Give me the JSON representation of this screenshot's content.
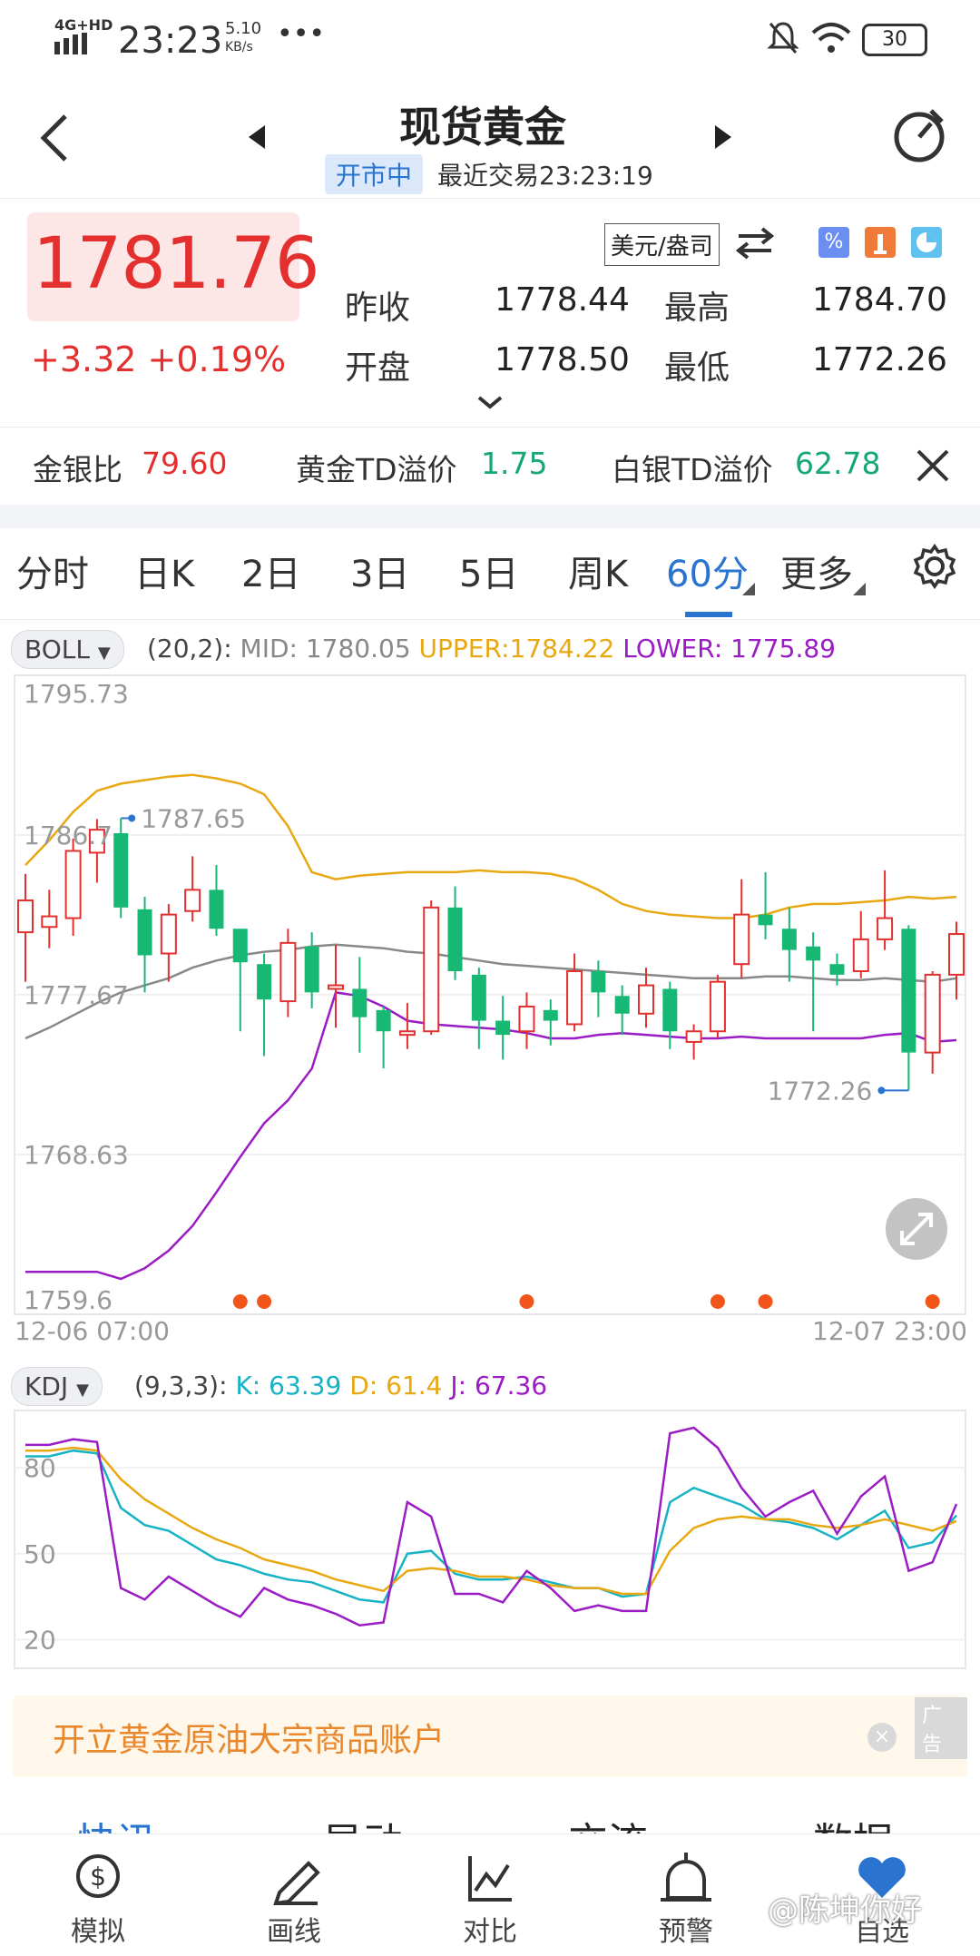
{
  "status": {
    "network": "4G+HD",
    "time": "23:23",
    "speed_value": "5.10",
    "speed_unit": "KB/s",
    "more": "•••",
    "battery": "30"
  },
  "header": {
    "title": "现货黄金",
    "market_status": "开市中",
    "last_trade": "最近交易23:23:19"
  },
  "quote": {
    "price": "1781.76",
    "change": "+3.32",
    "change_pct": "+0.19%",
    "unit": "美元/盎司",
    "prev_close_label": "昨收",
    "prev_close": "1778.44",
    "high_label": "最高",
    "high": "1784.70",
    "open_label": "开盘",
    "open": "1778.50",
    "low_label": "最低",
    "low": "1772.26"
  },
  "ratios": {
    "gold_silver_label": "金银比",
    "gold_silver": "79.60",
    "gold_td_label": "黄金TD溢价",
    "gold_td": "1.75",
    "silver_td_label": "白银TD溢价",
    "silver_td": "62.78"
  },
  "tabs": [
    "分时",
    "日K",
    "2日",
    "3日",
    "5日",
    "周K",
    "60分",
    "更多"
  ],
  "active_tab": "60分",
  "boll": {
    "name": "BOLL",
    "params": "(20,2):",
    "mid": "MID: 1780.05",
    "upper": "UPPER:1784.22",
    "lower": "LOWER: 1775.89"
  },
  "kdj": {
    "name": "KDJ",
    "params": "(9,3,3):",
    "k": "K: 63.39",
    "d": "D: 61.4",
    "j": "J: 67.36"
  },
  "chart_data": [
    {
      "type": "candlestick",
      "y_ticks": [
        "1795.73",
        "1786.7",
        "1777.67",
        "1768.63",
        "1759.6"
      ],
      "ylim": [
        1759.6,
        1795.73
      ],
      "x_start_label": "12-06 07:00",
      "x_end_label": "12-07 23:00",
      "max_annotation": "1787.65",
      "min_annotation": "1772.26",
      "candles": [
        {
          "o": 1781.2,
          "c": 1783.0,
          "h": 1784.5,
          "l": 1778.4
        },
        {
          "o": 1781.5,
          "c": 1782.1,
          "h": 1783.6,
          "l": 1780.3
        },
        {
          "o": 1782.0,
          "c": 1785.8,
          "h": 1786.5,
          "l": 1781.0
        },
        {
          "o": 1785.7,
          "c": 1787.0,
          "h": 1787.6,
          "l": 1784.0
        },
        {
          "o": 1786.8,
          "c": 1782.6,
          "h": 1787.65,
          "l": 1782.0
        },
        {
          "o": 1782.5,
          "c": 1779.9,
          "h": 1783.2,
          "l": 1777.8
        },
        {
          "o": 1780.0,
          "c": 1782.2,
          "h": 1782.8,
          "l": 1778.4
        },
        {
          "o": 1782.4,
          "c": 1783.6,
          "h": 1785.5,
          "l": 1781.8
        },
        {
          "o": 1783.6,
          "c": 1781.4,
          "h": 1785.0,
          "l": 1781.0
        },
        {
          "o": 1781.4,
          "c": 1779.5,
          "h": 1780.8,
          "l": 1775.6
        },
        {
          "o": 1779.4,
          "c": 1777.4,
          "h": 1780.0,
          "l": 1774.2
        },
        {
          "o": 1777.3,
          "c": 1780.6,
          "h": 1781.4,
          "l": 1776.4
        },
        {
          "o": 1780.4,
          "c": 1777.8,
          "h": 1781.2,
          "l": 1776.9
        },
        {
          "o": 1778.0,
          "c": 1778.2,
          "h": 1780.5,
          "l": 1775.8
        },
        {
          "o": 1778.0,
          "c": 1776.4,
          "h": 1779.8,
          "l": 1774.4
        },
        {
          "o": 1776.8,
          "c": 1775.6,
          "h": 1777.0,
          "l": 1773.5
        },
        {
          "o": 1775.4,
          "c": 1775.6,
          "h": 1777.2,
          "l": 1774.6
        },
        {
          "o": 1775.6,
          "c": 1782.6,
          "h": 1783.0,
          "l": 1775.4
        },
        {
          "o": 1782.6,
          "c": 1779.0,
          "h": 1783.8,
          "l": 1778.5
        },
        {
          "o": 1778.8,
          "c": 1776.2,
          "h": 1779.2,
          "l": 1774.6
        },
        {
          "o": 1776.2,
          "c": 1775.4,
          "h": 1777.6,
          "l": 1774.0
        },
        {
          "o": 1775.6,
          "c": 1777.0,
          "h": 1777.8,
          "l": 1774.6
        },
        {
          "o": 1776.8,
          "c": 1776.2,
          "h": 1777.4,
          "l": 1774.8
        },
        {
          "o": 1776.0,
          "c": 1779.0,
          "h": 1780.0,
          "l": 1775.6
        },
        {
          "o": 1779.0,
          "c": 1777.8,
          "h": 1779.6,
          "l": 1776.4
        },
        {
          "o": 1777.6,
          "c": 1776.6,
          "h": 1778.2,
          "l": 1775.4
        },
        {
          "o": 1776.6,
          "c": 1778.2,
          "h": 1779.2,
          "l": 1775.8
        },
        {
          "o": 1778.0,
          "c": 1775.6,
          "h": 1778.4,
          "l": 1774.6
        },
        {
          "o": 1775.0,
          "c": 1775.6,
          "h": 1776.0,
          "l": 1774.0
        },
        {
          "o": 1775.6,
          "c": 1778.4,
          "h": 1778.8,
          "l": 1775.2
        },
        {
          "o": 1779.4,
          "c": 1782.2,
          "h": 1784.2,
          "l": 1778.6
        },
        {
          "o": 1782.2,
          "c": 1781.6,
          "h": 1784.6,
          "l": 1780.8
        },
        {
          "o": 1781.4,
          "c": 1780.2,
          "h": 1782.6,
          "l": 1778.4
        },
        {
          "o": 1780.4,
          "c": 1779.6,
          "h": 1781.2,
          "l": 1775.6
        },
        {
          "o": 1779.4,
          "c": 1778.8,
          "h": 1780.0,
          "l": 1778.2
        },
        {
          "o": 1779.0,
          "c": 1780.8,
          "h": 1782.4,
          "l": 1778.6
        },
        {
          "o": 1780.8,
          "c": 1782.0,
          "h": 1784.7,
          "l": 1780.2
        },
        {
          "o": 1781.4,
          "c": 1774.4,
          "h": 1781.6,
          "l": 1772.26
        },
        {
          "o": 1774.4,
          "c": 1778.8,
          "h": 1779.0,
          "l": 1773.2
        },
        {
          "o": 1778.8,
          "c": 1781.1,
          "h": 1781.8,
          "l": 1777.4
        }
      ],
      "mid": [
        1775.2,
        1775.8,
        1776.5,
        1777.2,
        1777.8,
        1778.2,
        1778.6,
        1779.2,
        1779.6,
        1779.9,
        1780.1,
        1780.2,
        1780.4,
        1780.5,
        1780.4,
        1780.3,
        1780.1,
        1780.0,
        1779.8,
        1779.6,
        1779.4,
        1779.3,
        1779.2,
        1779.1,
        1779.0,
        1778.9,
        1778.8,
        1778.7,
        1778.6,
        1778.6,
        1778.6,
        1778.7,
        1778.7,
        1778.6,
        1778.5,
        1778.5,
        1778.6,
        1778.5,
        1778.4,
        1778.6
      ],
      "upper": [
        1785.0,
        1786.4,
        1788.0,
        1789.2,
        1789.6,
        1789.8,
        1790.0,
        1790.1,
        1789.9,
        1789.6,
        1789.0,
        1787.2,
        1784.6,
        1784.2,
        1784.4,
        1784.5,
        1784.6,
        1784.6,
        1784.6,
        1784.7,
        1784.6,
        1784.6,
        1784.5,
        1784.2,
        1783.6,
        1782.8,
        1782.4,
        1782.2,
        1782.1,
        1782.0,
        1782.0,
        1782.2,
        1782.6,
        1782.8,
        1782.8,
        1782.9,
        1783.0,
        1783.2,
        1783.1,
        1783.2
      ],
      "lower": [
        1762.0,
        1762.0,
        1762.0,
        1762.0,
        1761.6,
        1762.2,
        1763.2,
        1764.6,
        1766.5,
        1768.5,
        1770.4,
        1771.7,
        1773.5,
        1777.8,
        1777.6,
        1777.0,
        1776.2,
        1776.0,
        1775.9,
        1775.8,
        1775.7,
        1775.5,
        1775.2,
        1775.2,
        1775.4,
        1775.5,
        1775.4,
        1775.3,
        1775.2,
        1775.2,
        1775.3,
        1775.2,
        1775.2,
        1775.2,
        1775.2,
        1775.2,
        1775.4,
        1775.5,
        1775.0,
        1775.1
      ],
      "signal_dots_index": [
        9,
        10,
        21,
        29,
        31,
        38
      ]
    },
    {
      "type": "line",
      "y_ticks": [
        "80",
        "50",
        "20"
      ],
      "ylim": [
        10,
        100
      ],
      "series": [
        {
          "name": "K",
          "values": [
            84,
            84,
            86,
            85,
            66,
            60,
            58,
            53,
            48,
            46,
            43,
            41,
            40,
            37,
            34,
            33,
            50,
            51,
            43,
            41,
            41,
            42,
            40,
            38,
            38,
            35,
            36,
            68,
            73,
            70,
            67,
            62,
            61,
            59,
            55,
            60,
            65,
            52,
            54,
            63.39
          ]
        },
        {
          "name": "D",
          "values": [
            86,
            86,
            87,
            86,
            76,
            69,
            64,
            59,
            55,
            52,
            48,
            46,
            44,
            41,
            39,
            37,
            44,
            45,
            44,
            42,
            42,
            41,
            39,
            38,
            38,
            36,
            36,
            51,
            59,
            62,
            63,
            62,
            62,
            60,
            59,
            60,
            62,
            60,
            58,
            61.4
          ]
        },
        {
          "name": "J",
          "values": [
            88,
            88,
            90,
            89,
            38,
            34,
            42,
            37,
            32,
            28,
            38,
            34,
            32,
            29,
            25,
            26,
            68,
            63,
            36,
            36,
            33,
            44,
            38,
            30,
            32,
            30,
            30,
            92,
            94,
            87,
            73,
            63,
            68,
            72,
            57,
            70,
            77,
            44,
            47,
            67.36
          ]
        }
      ]
    }
  ],
  "ad": {
    "text": "开立黄金原油大宗商品账户",
    "tag": "广告"
  },
  "news_tabs": [
    "快讯",
    "异动",
    "交流",
    "数据"
  ],
  "bottom_nav": [
    "模拟",
    "画线",
    "对比",
    "预警",
    "自选"
  ],
  "watermark": "@陈坤你好",
  "colors": {
    "up": "#e3302f",
    "down": "#16b873",
    "accent": "#2a74d0",
    "upper": "#e8a812",
    "lower": "#9b1cc4",
    "mid": "#888888"
  }
}
